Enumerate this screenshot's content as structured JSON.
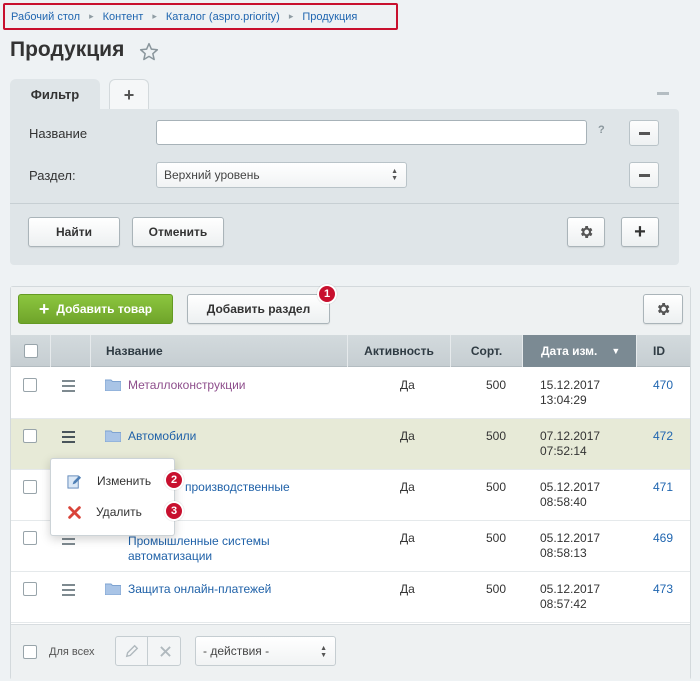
{
  "breadcrumb": {
    "items": [
      "Рабочий стол",
      "Контент",
      "Каталог (aspro.priority)",
      "Продукция"
    ],
    "separator": "▸"
  },
  "page": {
    "title": "Продукция"
  },
  "filter": {
    "tab_label": "Фильтр",
    "add_tab_icon": "+",
    "name_label": "Название",
    "name_value": "",
    "help": "?",
    "section_label": "Раздел:",
    "section_value": "Верхний уровень",
    "find_button": "Найти",
    "cancel_button": "Отменить"
  },
  "toolbar": {
    "add_product": "Добавить товар",
    "add_section": "Добавить раздел",
    "badge_1": "1"
  },
  "table": {
    "columns": [
      "Название",
      "Активность",
      "Сорт.",
      "Дата изм.",
      "ID"
    ],
    "sort_indicator": "▼",
    "rows": [
      {
        "name": "Металлоконструкции",
        "active": "Да",
        "sort": "500",
        "date": "15.12.2017",
        "time": "13:04:29",
        "id": "470"
      },
      {
        "name": "Автомобили",
        "active": "Да",
        "sort": "500",
        "date": "07.12.2017",
        "time": "07:52:14",
        "id": "472"
      },
      {
        "name": "производственные",
        "active": "Да",
        "sort": "500",
        "date": "05.12.2017",
        "time": "08:58:40",
        "id": "471"
      },
      {
        "name_line1": "Промышленные системы",
        "name_line2": "автоматизации",
        "active": "Да",
        "sort": "500",
        "date": "05.12.2017",
        "time": "08:58:13",
        "id": "469"
      },
      {
        "name": "Защита онлайн-платежей",
        "active": "Да",
        "sort": "500",
        "date": "05.12.2017",
        "time": "08:57:42",
        "id": "473"
      }
    ]
  },
  "context_menu": {
    "edit": "Изменить",
    "delete": "Удалить",
    "badge_2": "2",
    "badge_3": "3"
  },
  "footer": {
    "for_all": "Для всех",
    "actions": "- действия -"
  },
  "colors": {
    "accent_green": "#7ab538",
    "badge_red": "#c8102e",
    "link_blue": "#1f61a8"
  }
}
